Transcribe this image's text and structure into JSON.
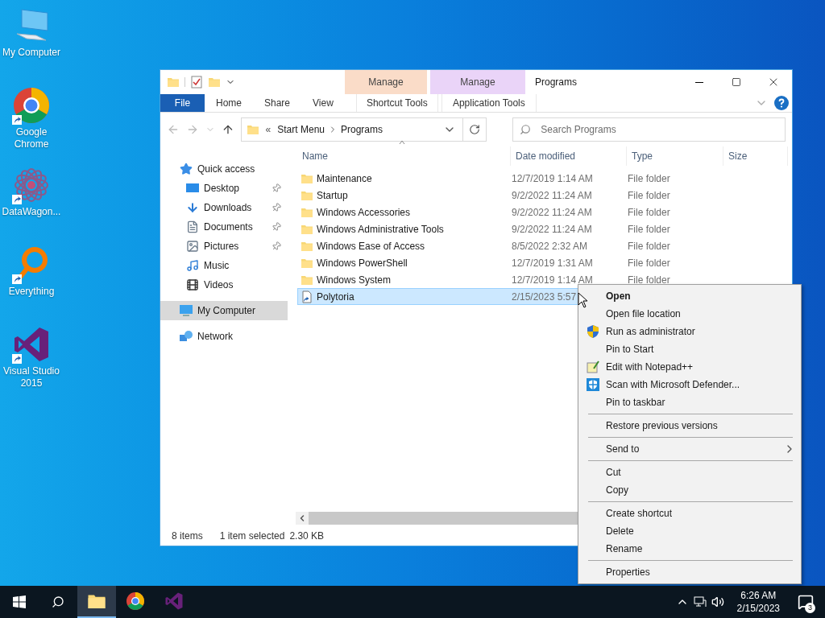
{
  "desktop_icons": [
    {
      "label": "My Computer",
      "kind": "computer",
      "shortcut": false
    },
    {
      "label": "Google Chrome",
      "kind": "chrome",
      "shortcut": true
    },
    {
      "label": "DataWagon...",
      "kind": "datawagon",
      "shortcut": true
    },
    {
      "label": "Everything",
      "kind": "everything",
      "shortcut": true
    },
    {
      "label": "Visual Studio 2015",
      "kind": "vs",
      "shortcut": true
    }
  ],
  "window": {
    "title": "Programs",
    "ribbon_tabs": [
      {
        "label": "File",
        "kind": "file"
      },
      {
        "label": "Home",
        "kind": "plain"
      },
      {
        "label": "Share",
        "kind": "plain"
      },
      {
        "label": "View",
        "kind": "plain"
      }
    ],
    "context_tabs": [
      {
        "header": "Manage",
        "label": "Shortcut Tools",
        "color": "#fadcc8"
      },
      {
        "header": "Manage",
        "label": "Application Tools",
        "color": "#ead4f8"
      }
    ],
    "address": {
      "prefix": "«",
      "path": [
        "Start Menu",
        "Programs"
      ]
    },
    "search": {
      "placeholder": "Search Programs"
    },
    "nav": [
      {
        "label": "Quick access",
        "kind": "star",
        "pinned": false,
        "selected": false,
        "children": [
          {
            "label": "Desktop",
            "kind": "desktop",
            "pinned": true,
            "selected": false
          },
          {
            "label": "Downloads",
            "kind": "downloads",
            "pinned": true,
            "selected": false
          },
          {
            "label": "Documents",
            "kind": "documents",
            "pinned": true,
            "selected": false
          },
          {
            "label": "Pictures",
            "kind": "pictures",
            "pinned": true,
            "selected": false
          },
          {
            "label": "Music",
            "kind": "music",
            "pinned": false,
            "selected": false
          },
          {
            "label": "Videos",
            "kind": "videos",
            "pinned": false,
            "selected": false
          }
        ]
      },
      {
        "label": "My Computer",
        "kind": "computer",
        "pinned": false,
        "selected": true
      },
      {
        "label": "Network",
        "kind": "network",
        "pinned": false,
        "selected": false
      }
    ],
    "columns": [
      "Name",
      "Date modified",
      "Type",
      "Size"
    ],
    "rows": [
      {
        "name": "Maintenance",
        "date": "12/7/2019 1:14 AM",
        "type": "File folder",
        "kind": "folder",
        "selected": false
      },
      {
        "name": "Startup",
        "date": "9/2/2022 11:24 AM",
        "type": "File folder",
        "kind": "folder",
        "selected": false
      },
      {
        "name": "Windows Accessories",
        "date": "9/2/2022 11:24 AM",
        "type": "File folder",
        "kind": "folder",
        "selected": false
      },
      {
        "name": "Windows Administrative Tools",
        "date": "9/2/2022 11:24 AM",
        "type": "File folder",
        "kind": "folder",
        "selected": false
      },
      {
        "name": "Windows Ease of Access",
        "date": "8/5/2022 2:32 AM",
        "type": "File folder",
        "kind": "folder",
        "selected": false
      },
      {
        "name": "Windows PowerShell",
        "date": "12/7/2019 1:31 AM",
        "type": "File folder",
        "kind": "folder",
        "selected": false
      },
      {
        "name": "Windows System",
        "date": "12/7/2019 1:14 AM",
        "type": "File folder",
        "kind": "folder",
        "selected": false
      },
      {
        "name": "Polytoria",
        "date": "2/15/2023 5:57",
        "kind": "shortcut",
        "selected": true
      }
    ],
    "status": {
      "count": "8 items",
      "selection": "1 item selected",
      "size": "2.30 KB"
    }
  },
  "context_menu": {
    "groups": [
      [
        {
          "label": "Open",
          "bold": true,
          "submenu": false
        },
        {
          "label": "Open file location",
          "bold": false,
          "submenu": false
        },
        {
          "label": "Run as administrator",
          "bold": false,
          "submenu": false
        },
        {
          "label": "Pin to Start",
          "bold": false,
          "submenu": false
        },
        {
          "label": "Edit with Notepad++",
          "bold": false,
          "submenu": false
        },
        {
          "label": "Scan with Microsoft Defender...",
          "bold": false,
          "submenu": false
        },
        {
          "label": "Pin to taskbar",
          "bold": false,
          "submenu": false
        }
      ],
      [
        {
          "label": "Restore previous versions",
          "bold": false,
          "submenu": false
        }
      ],
      [
        {
          "label": "Send to",
          "bold": false,
          "submenu": true
        }
      ],
      [
        {
          "label": "Cut",
          "bold": false,
          "submenu": false
        },
        {
          "label": "Copy",
          "bold": false,
          "submenu": false
        }
      ],
      [
        {
          "label": "Create shortcut",
          "bold": false,
          "submenu": false
        },
        {
          "label": "Delete",
          "bold": false,
          "submenu": false
        },
        {
          "label": "Rename",
          "bold": false,
          "submenu": false
        }
      ],
      [
        {
          "label": "Properties",
          "bold": false,
          "submenu": false
        }
      ]
    ]
  },
  "taskbar": {
    "apps": [
      {
        "kind": "explorer",
        "active": true
      },
      {
        "kind": "chrome",
        "active": false
      },
      {
        "kind": "vs",
        "active": false
      }
    ],
    "time": "6:26 AM",
    "date": "2/15/2023",
    "notifications": "3"
  }
}
